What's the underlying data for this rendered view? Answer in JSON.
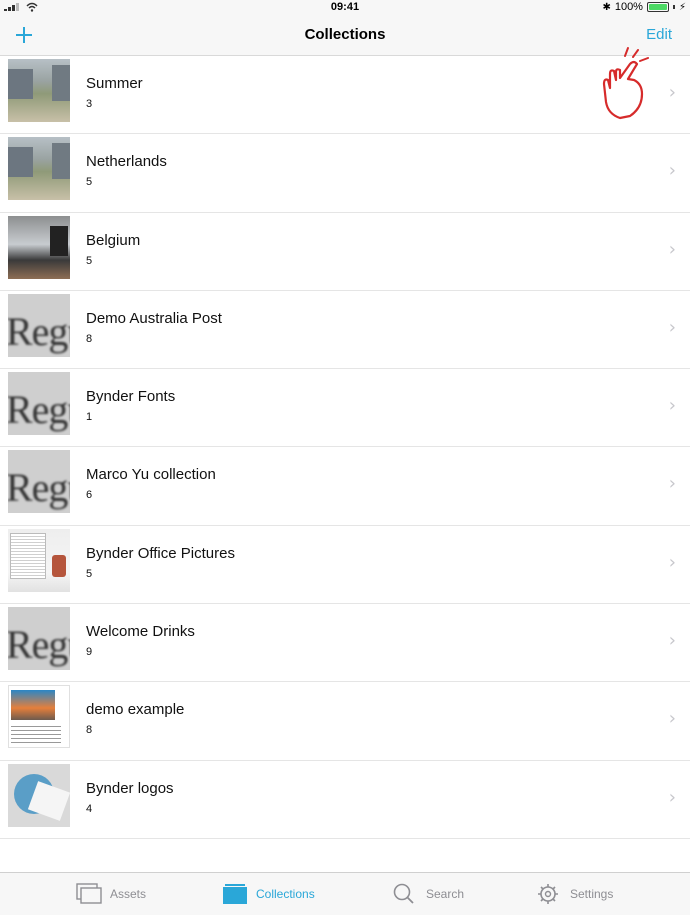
{
  "status_bar": {
    "time": "09:41",
    "battery": "100%"
  },
  "nav": {
    "add_label": "+",
    "title": "Collections",
    "edit_label": "Edit"
  },
  "collections": [
    {
      "name": "Summer",
      "count": "3",
      "thumb": "city"
    },
    {
      "name": "Netherlands",
      "count": "5",
      "thumb": "city"
    },
    {
      "name": "Belgium",
      "count": "5",
      "thumb": "office"
    },
    {
      "name": "Demo Australia Post",
      "count": "8",
      "thumb": "font"
    },
    {
      "name": "Bynder Fonts",
      "count": "1",
      "thumb": "font"
    },
    {
      "name": "Marco Yu collection",
      "count": "6",
      "thumb": "font"
    },
    {
      "name": "Bynder Office Pictures",
      "count": "5",
      "thumb": "desk"
    },
    {
      "name": "Welcome Drinks",
      "count": "9",
      "thumb": "font"
    },
    {
      "name": "demo example",
      "count": "8",
      "thumb": "web"
    },
    {
      "name": "Bynder logos",
      "count": "4",
      "thumb": "logo"
    }
  ],
  "tabs": [
    {
      "label": "Assets",
      "icon": "assets-icon",
      "active": false
    },
    {
      "label": "Collections",
      "icon": "collections-icon",
      "active": true
    },
    {
      "label": "Search",
      "icon": "search-icon",
      "active": false
    },
    {
      "label": "Settings",
      "icon": "settings-icon",
      "active": false
    }
  ],
  "colors": {
    "accent": "#2aa7d8",
    "inactive": "#8e8e93",
    "hand": "#d62b2b"
  }
}
